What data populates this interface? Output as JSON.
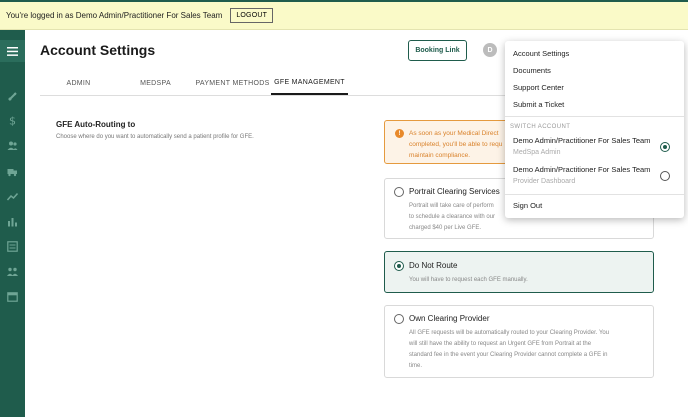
{
  "banner": {
    "message": "You're logged in as Demo Admin/Practitioner For Sales Team",
    "logout": "LOGOUT"
  },
  "sidebar": {
    "icons": [
      "menu-icon",
      "syringe-icon",
      "dollar-icon",
      "users-icon",
      "truck-icon",
      "trend-icon",
      "bar-chart-icon",
      "list-icon",
      "group-icon",
      "calendar-icon"
    ]
  },
  "header": {
    "title": "Account Settings",
    "booking_link": "Booking Link",
    "avatar": "D"
  },
  "tabs": [
    {
      "label": "ADMIN",
      "active": false
    },
    {
      "label": "MEDSPA",
      "active": false
    },
    {
      "label": "PAYMENT METHODS",
      "active": false
    },
    {
      "label": "GFE MANAGEMENT",
      "active": true
    }
  ],
  "section": {
    "title": "GFE Auto-Routing to",
    "description": "Choose where do you want to automatically send a patient profile for GFE."
  },
  "alert": {
    "line1": "As soon as your Medical Direct",
    "line2": "completed, you'll be able to requ",
    "line3": "maintain compliance."
  },
  "options": [
    {
      "label": "Portrait Clearing Services",
      "selected": false,
      "lines": [
        "Portrait will take care of perform",
        "to schedule a clearance with our",
        "charged $40 per Live GFE."
      ]
    },
    {
      "label": "Do Not Route",
      "selected": true,
      "lines": [
        "You will have to request each GFE manually."
      ]
    },
    {
      "label": "Own Clearing Provider",
      "selected": false,
      "lines": [
        "All GFE requests will be automatically routed to your Clearing Provider. You",
        "will still have the ability to request an Urgent GFE from Portrait at the",
        "standard fee in the event your Clearing Provider cannot complete a GFE in",
        "time."
      ]
    }
  ],
  "dropdown": {
    "items": [
      "Account Settings",
      "Documents",
      "Support Center",
      "Submit a Ticket"
    ],
    "switch_header": "SWITCH ACCOUNT",
    "accounts": [
      {
        "name": "Demo Admin/Practitioner For Sales Team",
        "sub": "MedSpa Admin",
        "selected": true
      },
      {
        "name": "Demo Admin/Practitioner For Sales Team",
        "sub": "Provider Dashboard",
        "selected": false
      }
    ],
    "sign_out": "Sign Out"
  },
  "colors": {
    "brand": "#1f5c4c",
    "banner": "#fafac8",
    "warning": "#e8892a"
  }
}
